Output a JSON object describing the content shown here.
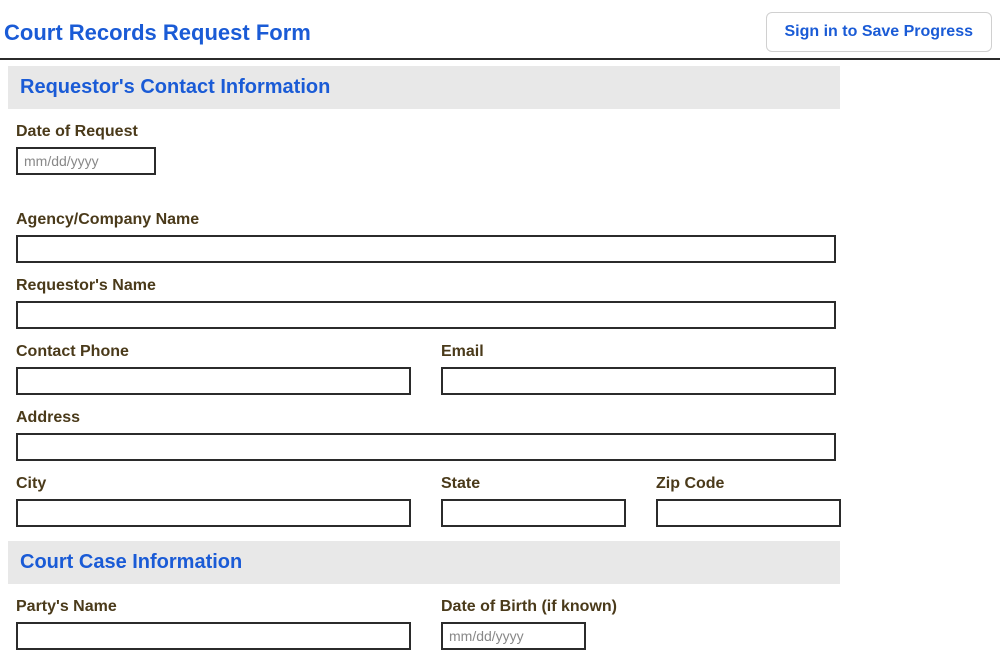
{
  "header": {
    "title": "Court Records Request Form",
    "signin_label": "Sign in to Save Progress"
  },
  "sections": {
    "requestor": {
      "title": "Requestor's Contact Information",
      "fields": {
        "date_of_request": {
          "label": "Date of Request",
          "placeholder": "mm/dd/yyyy"
        },
        "agency_company": {
          "label": "Agency/Company Name"
        },
        "requestor_name": {
          "label": "Requestor's Name"
        },
        "contact_phone": {
          "label": "Contact Phone"
        },
        "email": {
          "label": "Email"
        },
        "address": {
          "label": "Address"
        },
        "city": {
          "label": "City"
        },
        "state": {
          "label": "State"
        },
        "zip": {
          "label": "Zip Code"
        }
      }
    },
    "court_case": {
      "title": "Court Case Information",
      "fields": {
        "party_name": {
          "label": "Party's Name"
        },
        "dob": {
          "label": "Date of Birth (if known)",
          "placeholder": "mm/dd/yyyy"
        }
      }
    }
  }
}
